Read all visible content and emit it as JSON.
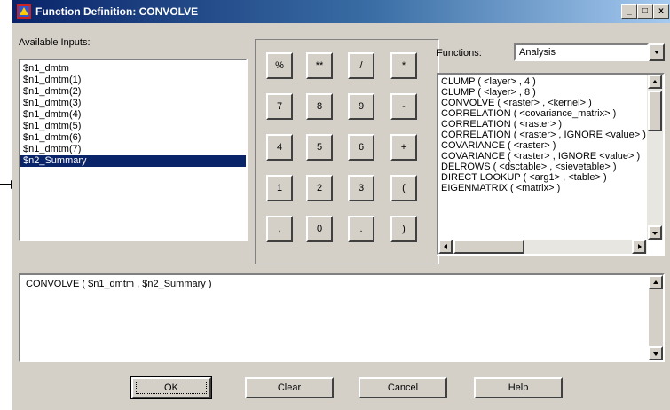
{
  "window": {
    "title": "Function Definition: CONVOLVE",
    "minimize": "_",
    "maximize": "□",
    "close": "x"
  },
  "inputs": {
    "label": "Available Inputs:",
    "items": [
      "$n1_dmtm",
      "$n1_dmtm(1)",
      "$n1_dmtm(2)",
      "$n1_dmtm(3)",
      "$n1_dmtm(4)",
      "$n1_dmtm(5)",
      "$n1_dmtm(6)",
      "$n1_dmtm(7)",
      "$n2_Summary"
    ],
    "selected_index": 8
  },
  "keypad": {
    "keys": [
      "%",
      "**",
      "/",
      "*",
      "7",
      "8",
      "9",
      "-",
      "4",
      "5",
      "6",
      "+",
      "1",
      "2",
      "3",
      "(",
      ",",
      "0",
      ".",
      ")"
    ]
  },
  "functions": {
    "label": "Functions:",
    "category": "Analysis",
    "items": [
      "CLUMP ( <layer> , 4 )",
      "CLUMP ( <layer> , 8 )",
      "CONVOLVE ( <raster> , <kernel> )",
      "CORRELATION ( <covariance_matrix> )",
      "CORRELATION ( <raster> )",
      "CORRELATION ( <raster> , IGNORE <value> )",
      "COVARIANCE ( <raster> )",
      "COVARIANCE ( <raster> , IGNORE <value> )",
      "DELROWS ( <dsctable> , <sievetable> )",
      "DIRECT LOOKUP ( <arg1> , <table> )",
      "EIGENMATRIX ( <matrix> )"
    ]
  },
  "expression": {
    "text": "CONVOLVE ( $n1_dmtm , $n2_Summary )"
  },
  "buttons": {
    "ok": "OK",
    "clear": "Clear",
    "cancel": "Cancel",
    "help": "Help"
  },
  "colors": {
    "selection": "#0a246a",
    "face": "#d4d0c8",
    "title_start": "#0a246a",
    "title_end": "#a6caf0"
  }
}
